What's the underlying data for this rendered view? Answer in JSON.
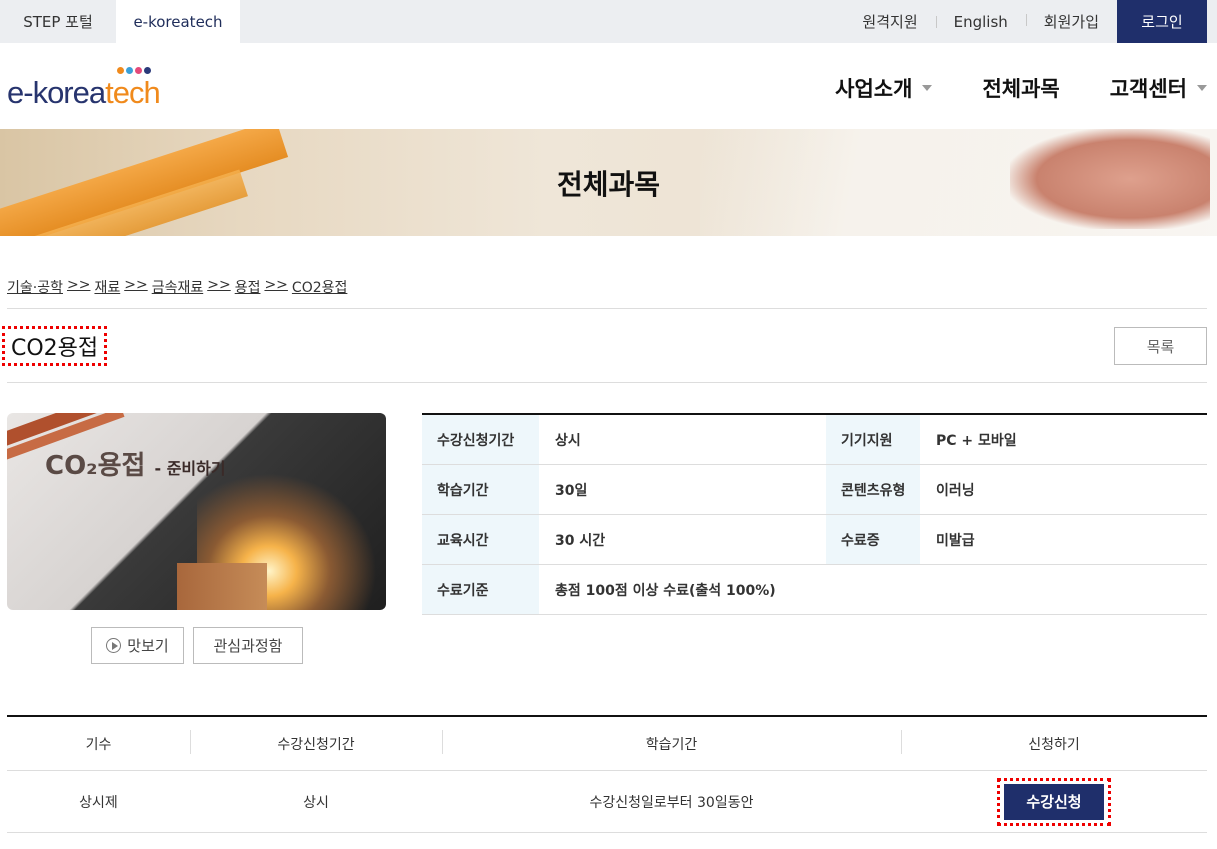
{
  "topbar": {
    "portal_step": "STEP 포털",
    "portal_ekt": "e-koreatech",
    "links": [
      "원격지원",
      "English",
      "회원가입"
    ],
    "login": "로그인"
  },
  "header": {
    "logo_main": "e-korea",
    "logo_accent": "tech",
    "logo_dot_colors": [
      "#f08a1c",
      "#3aa0d8",
      "#e44a7a",
      "#2a3a7a"
    ],
    "nav": [
      "사업소개",
      "전체과목",
      "고객센터"
    ]
  },
  "banner": {
    "title": "전체과목"
  },
  "breadcrumb": [
    "기술·공학",
    "재료",
    "금속재료",
    "용접",
    "CO2용접"
  ],
  "breadcrumb_sep": ">>",
  "course": {
    "title": "CO2용접",
    "list_button": "목록",
    "thumb_title": "CO₂용접",
    "thumb_sub": "- 준비하기",
    "preview_button": "맛보기",
    "favorite_button": "관심과정함"
  },
  "info": {
    "rows": [
      {
        "label1": "수강신청기간",
        "value1": "상시",
        "label2": "기기지원",
        "value2": "PC + 모바일"
      },
      {
        "label1": "학습기간",
        "value1": "30일",
        "label2": "콘텐츠유형",
        "value2": "이러닝"
      },
      {
        "label1": "교육시간",
        "value1": "30 시간",
        "label2": "수료증",
        "value2": "미발급"
      },
      {
        "label1": "수료기준",
        "value1": "총점 100점 이상 수료(출석 100%)",
        "label2": "",
        "value2": ""
      }
    ]
  },
  "schedule": {
    "headers": [
      "기수",
      "수강신청기간",
      "학습기간",
      "신청하기"
    ],
    "row": {
      "term": "상시제",
      "period": "상시",
      "duration": "수강신청일로부터 30일동안",
      "apply": "수강신청"
    }
  },
  "colors": {
    "navy": "#1f2f6b",
    "orange": "#f08a1c",
    "highlight": "#e00000",
    "th_bg": "#eef7fb"
  }
}
